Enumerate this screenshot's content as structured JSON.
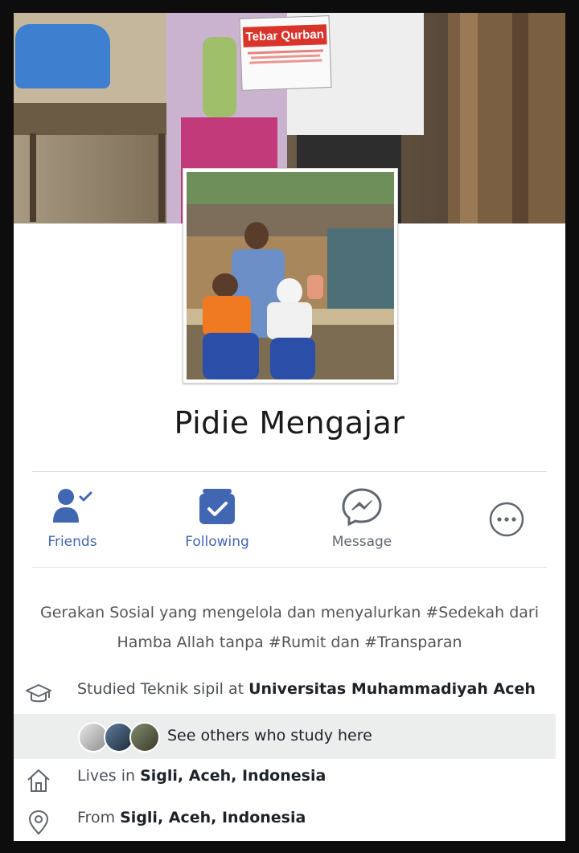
{
  "page": {
    "name": "Pidie Mengajar",
    "bio": "Gerakan Sosial yang mengelola dan menyalurkan #Sedekah dari Hamba Allah tanpa #Rumit dan #Transparan"
  },
  "cover": {
    "sign_text": "Tebar Qurban"
  },
  "actions": [
    {
      "label": "Friends",
      "icon": "friends-check-icon",
      "color": "#4267b2"
    },
    {
      "label": "Following",
      "icon": "following-check-icon",
      "color": "#4267b2"
    },
    {
      "label": "Message",
      "icon": "messenger-icon",
      "color": "#606770"
    },
    {
      "label": "",
      "icon": "more-icon",
      "color": "#606770"
    }
  ],
  "about": {
    "education": {
      "prefix": "Studied Teknik sipil at ",
      "school": "Universitas Muhammadiyah Aceh",
      "icon": "graduation-cap-icon"
    },
    "see_others": {
      "label": "See others who study here"
    },
    "lives": {
      "prefix": "Lives in ",
      "place": "Sigli, Aceh, Indonesia",
      "icon": "home-icon"
    },
    "from": {
      "prefix": "From ",
      "place": "Sigli, Aceh, Indonesia",
      "icon": "location-pin-icon"
    }
  },
  "colors": {
    "accent": "#4267b2",
    "text": "#1d2129",
    "muted": "#606770",
    "highlight_row": "#eceded"
  }
}
